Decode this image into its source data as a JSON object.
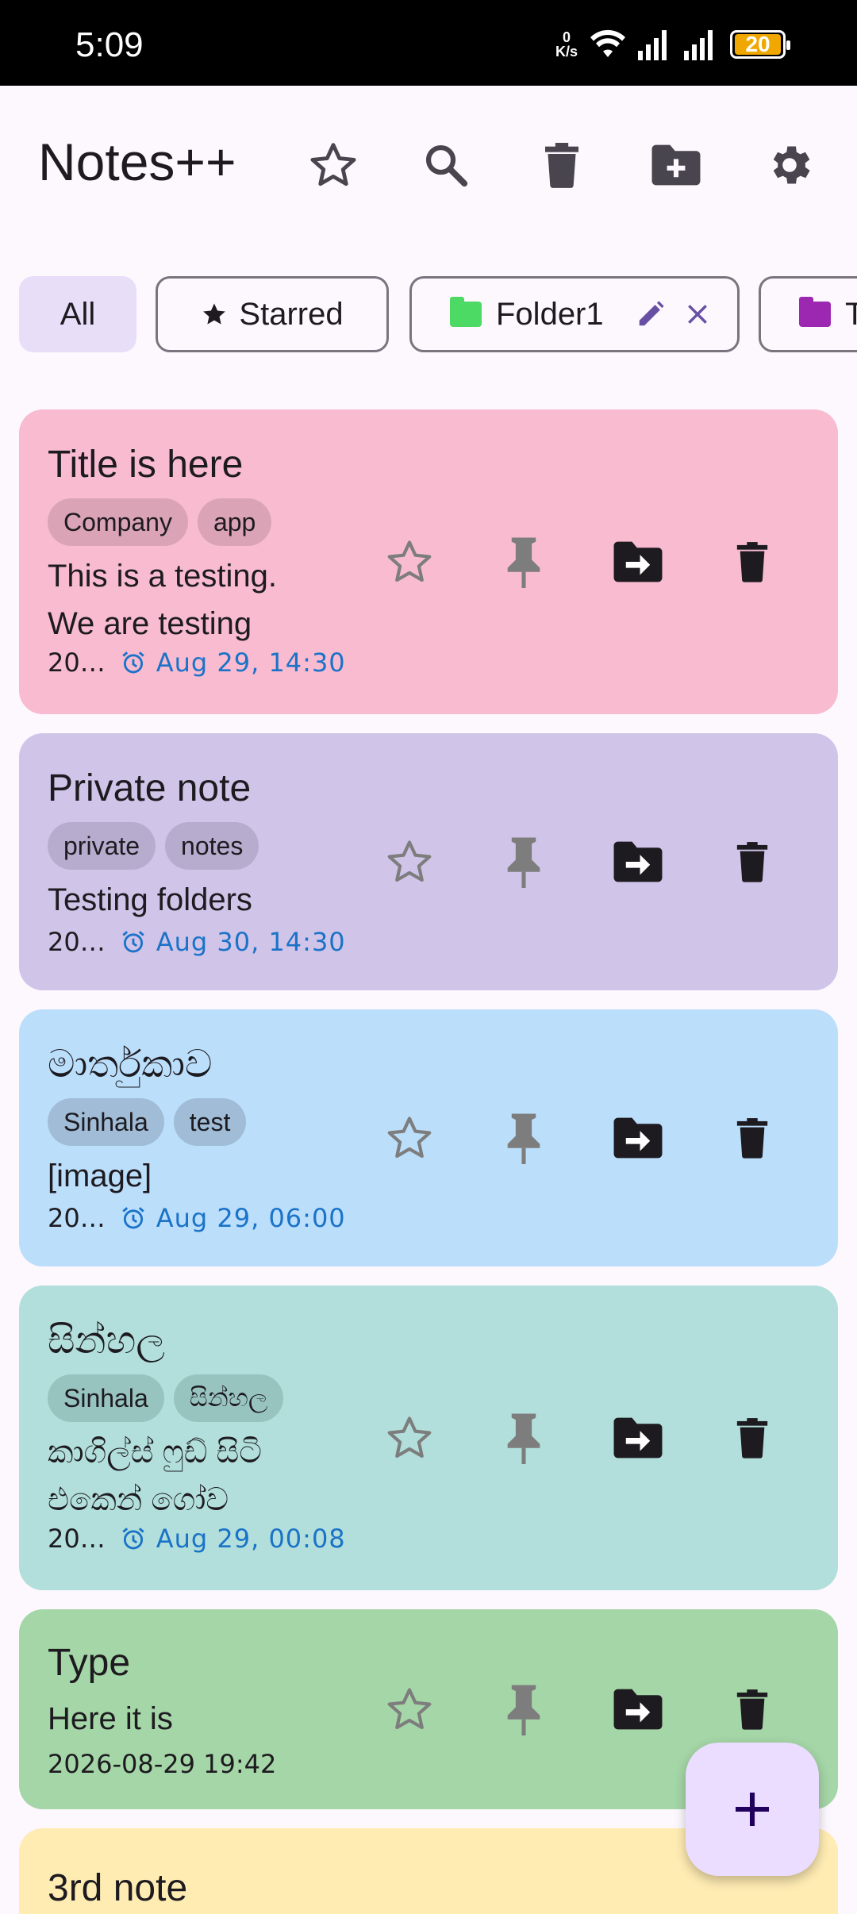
{
  "status_bar": {
    "time": "5:09",
    "net_speed_value": "0",
    "net_speed_unit": "K/s",
    "battery": "20"
  },
  "header": {
    "title": "Notes++"
  },
  "chips": {
    "all": "All",
    "starred": "Starred",
    "folder1": "Folder1",
    "folder2_partial": "T",
    "folder1_color": "#4cd964",
    "folder2_color": "#9c27b0"
  },
  "notes": [
    {
      "title": "Title is here",
      "tags": [
        "Company",
        "app"
      ],
      "body": "This is a testing.\nWe are testing",
      "date": "20…",
      "reminder": "Aug 29, 14:30",
      "color": "#f8bbd0"
    },
    {
      "title": "Private note",
      "tags": [
        "private",
        "notes"
      ],
      "body": "Testing folders",
      "date": "20…",
      "reminder": "Aug 30, 14:30",
      "color": "#d1c4e9"
    },
    {
      "title": "මාර්තුකාව",
      "tags": [
        "Sinhala",
        "test"
      ],
      "body": "[image]",
      "date": "20…",
      "reminder": "Aug 29, 06:00",
      "color": "#bbdefb"
    },
    {
      "title": "සින්හල",
      "tags": [
        "Sinhala",
        "සින්හල"
      ],
      "body": "කාගිල්ස් ෆුඩ් සිටි\nඑකෙන් ගෝව",
      "date": "20…",
      "reminder": "Aug 29, 00:08",
      "color": "#b2dfdb"
    },
    {
      "title": "Type",
      "tags": [],
      "body": "Here it is",
      "date": "2026-08-29 19:42",
      "reminder": "",
      "color": "#a5d6a7"
    },
    {
      "title": "3rd note",
      "tags": [],
      "body": "",
      "date": "",
      "reminder": "",
      "color": "#ffecb3"
    }
  ],
  "icons": {
    "header": [
      "star-outline-icon",
      "search-icon",
      "trash-icon",
      "folder-add-icon",
      "gear-icon"
    ],
    "card_actions": [
      "star-outline-icon",
      "pin-icon",
      "move-to-folder-icon",
      "trash-icon"
    ],
    "fab": "plus-icon"
  }
}
